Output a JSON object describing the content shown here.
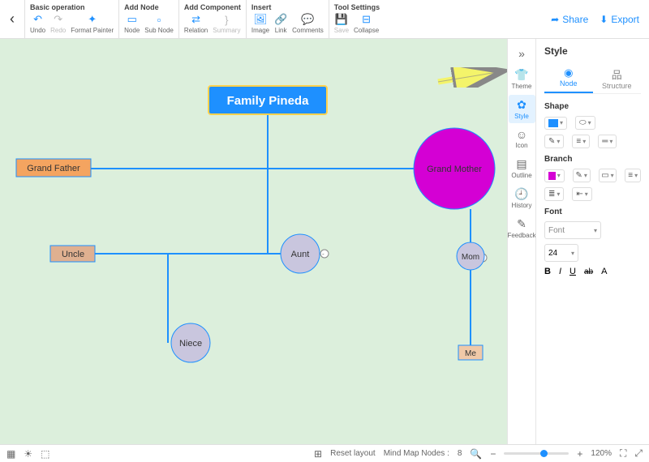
{
  "toolbar": {
    "groups": {
      "basic": {
        "title": "Basic operation",
        "undo": "Undo",
        "redo": "Redo",
        "format_painter": "Format Painter"
      },
      "addnode": {
        "title": "Add Node",
        "node": "Node",
        "subnode": "Sub Node"
      },
      "addcomp": {
        "title": "Add Component",
        "relation": "Relation",
        "summary": "Summary"
      },
      "insert": {
        "title": "Insert",
        "image": "Image",
        "link": "Link",
        "comments": "Comments"
      },
      "tools": {
        "title": "Tool Settings",
        "save": "Save",
        "collapse": "Collapse"
      }
    },
    "share": "Share",
    "export": "Export"
  },
  "siderail": {
    "theme": "Theme",
    "style": "Style",
    "icon": "Icon",
    "outline": "Outline",
    "history": "History",
    "feedback": "Feedback"
  },
  "panel": {
    "title": "Style",
    "tabs": {
      "node": "Node",
      "structure": "Structure"
    },
    "sections": {
      "shape": "Shape",
      "branch": "Branch",
      "font": "Font"
    },
    "font_placeholder": "Font",
    "font_size": "24",
    "format_buttons": {
      "bold": "B",
      "italic": "I",
      "underline": "U",
      "strike": "ab",
      "color": "A"
    }
  },
  "nodes": {
    "root": "Family Pineda",
    "grandfather": "Grand Father",
    "grandmother": "Grand Mother",
    "uncle": "Uncle",
    "aunt": "Aunt",
    "mom": "Mom",
    "niece": "Niece",
    "me": "Me"
  },
  "status": {
    "reset": "Reset layout",
    "nodes_label": "Mind Map Nodes :",
    "nodes_count": "8",
    "zoom": "120%"
  },
  "chart_data": {
    "type": "mindmap",
    "title": "Family Pineda",
    "root": {
      "label": "Family Pineda",
      "shape": "rect",
      "fill": "#1e90ff",
      "text_color": "#fff",
      "outline": "#ffd24d",
      "children": [
        {
          "label": "Grand Father",
          "shape": "rect",
          "fill": "#f4a460",
          "children": []
        },
        {
          "label": "Grand Mother",
          "shape": "circle",
          "fill": "#d400d4",
          "children": [
            {
              "label": "Mom",
              "shape": "circle",
              "fill": "#c9c6de",
              "children": [
                {
                  "label": "Me",
                  "shape": "rect",
                  "fill": "#f0c9a8",
                  "children": []
                }
              ]
            }
          ]
        },
        {
          "label": "Uncle",
          "shape": "rect",
          "fill": "#e0b090",
          "children": [
            {
              "label": "Niece",
              "shape": "circle",
              "fill": "#c9c6de",
              "children": []
            }
          ]
        },
        {
          "label": "Aunt",
          "shape": "circle",
          "fill": "#c9c6de",
          "children": []
        }
      ]
    }
  }
}
